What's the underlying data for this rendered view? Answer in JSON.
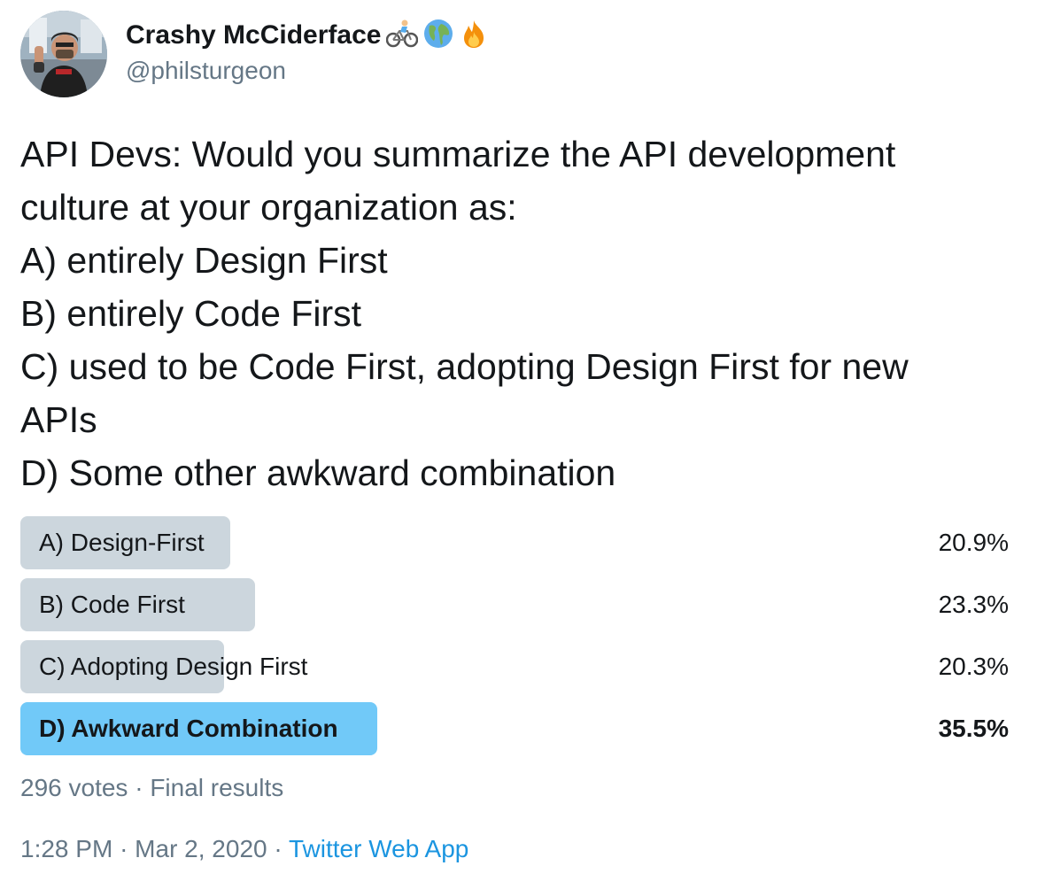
{
  "author": {
    "display_name": "Crashy McCiderface",
    "handle": "@philsturgeon",
    "name_emojis": [
      "bicyclist-icon",
      "globe-icon",
      "fire-icon"
    ]
  },
  "tweet": {
    "lines": [
      "API Devs: Would you summarize the API development",
      "culture at your organization as:",
      "A) entirely Design First",
      "B) entirely Code First",
      "C) used to be Code First, adopting Design First for new",
      "APIs",
      "D) Some other awkward combination"
    ]
  },
  "poll": {
    "options": [
      {
        "label": "A) Design-First",
        "percent_text": "20.9%",
        "percent": 20.9,
        "winner": false
      },
      {
        "label": "B) Code First",
        "percent_text": "23.3%",
        "percent": 23.3,
        "winner": false
      },
      {
        "label": "C) Adopting Design First",
        "percent_text": "20.3%",
        "percent": 20.3,
        "winner": false
      },
      {
        "label": "D) Awkward Combination",
        "percent_text": "35.5%",
        "percent": 35.5,
        "winner": true
      }
    ],
    "votes": "296 votes",
    "separator": "·",
    "status": "Final results"
  },
  "meta": {
    "time": "1:28 PM",
    "separator": "·",
    "date": "Mar 2, 2020",
    "source": "Twitter Web App"
  },
  "colors": {
    "bar": "#ccd6dd",
    "bar_winner": "#71c9f8",
    "secondary_text": "#657786",
    "link": "#1b95e0"
  }
}
